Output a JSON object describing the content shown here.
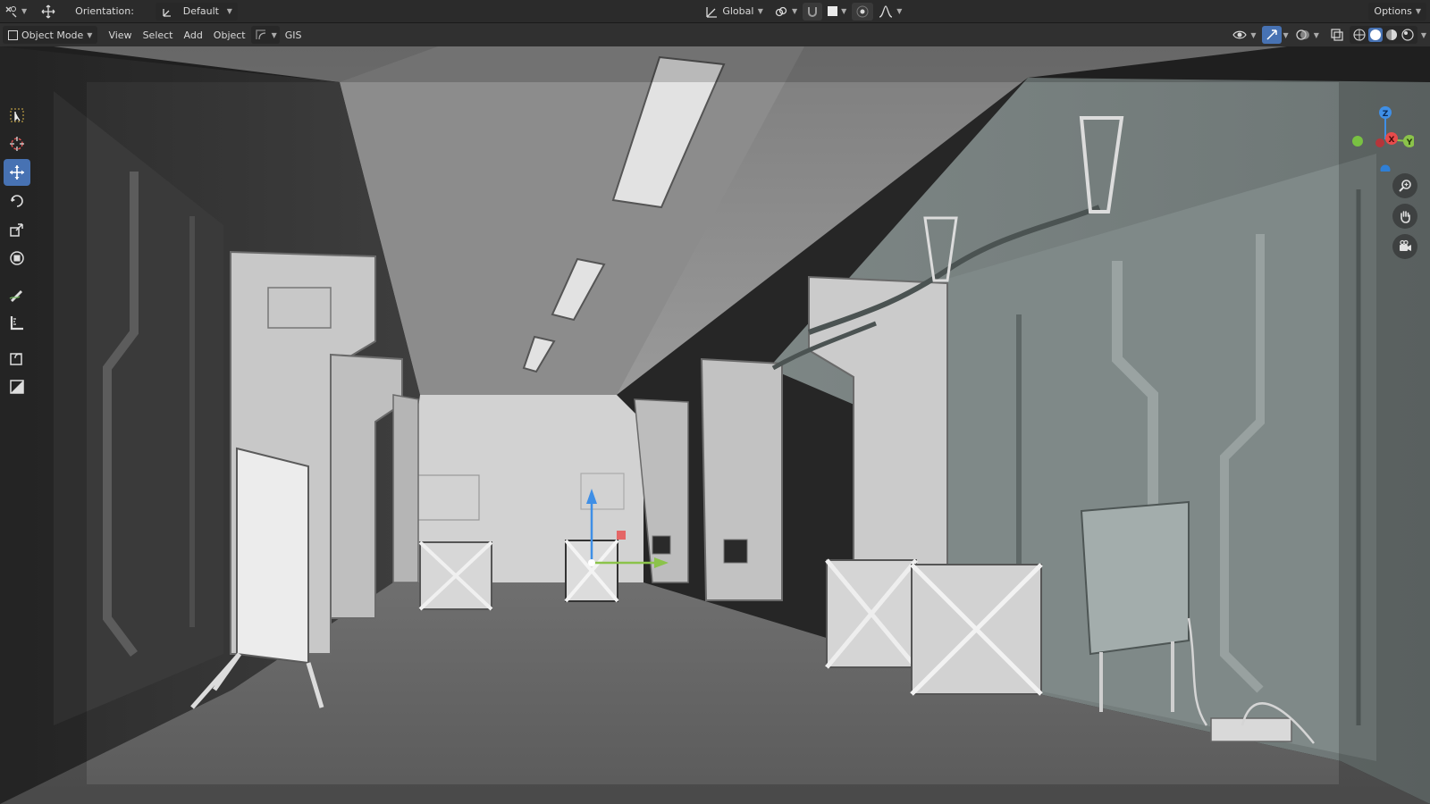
{
  "header": {
    "orientation_label": "Orientation:",
    "orientation_value": "Default",
    "transform_space": "Global",
    "options_label": "Options"
  },
  "menubar": {
    "mode": "Object Mode",
    "menus": [
      "View",
      "Select",
      "Add",
      "Object"
    ],
    "gis_label": "GIS"
  },
  "toolbar": {
    "tools": [
      "select-box",
      "cursor",
      "move",
      "rotate",
      "scale",
      "transform",
      "annotate",
      "measure",
      "add-cube",
      "add-plane"
    ],
    "active_tool": "move"
  },
  "gizmo": {
    "axes": [
      "Z",
      "X",
      "Y"
    ],
    "colors": {
      "x": "#e84b4b",
      "y": "#8bc34a",
      "z": "#3f8fe6"
    }
  },
  "colors": {
    "accent": "#4772b3",
    "header_bg": "#2b2b2b"
  }
}
